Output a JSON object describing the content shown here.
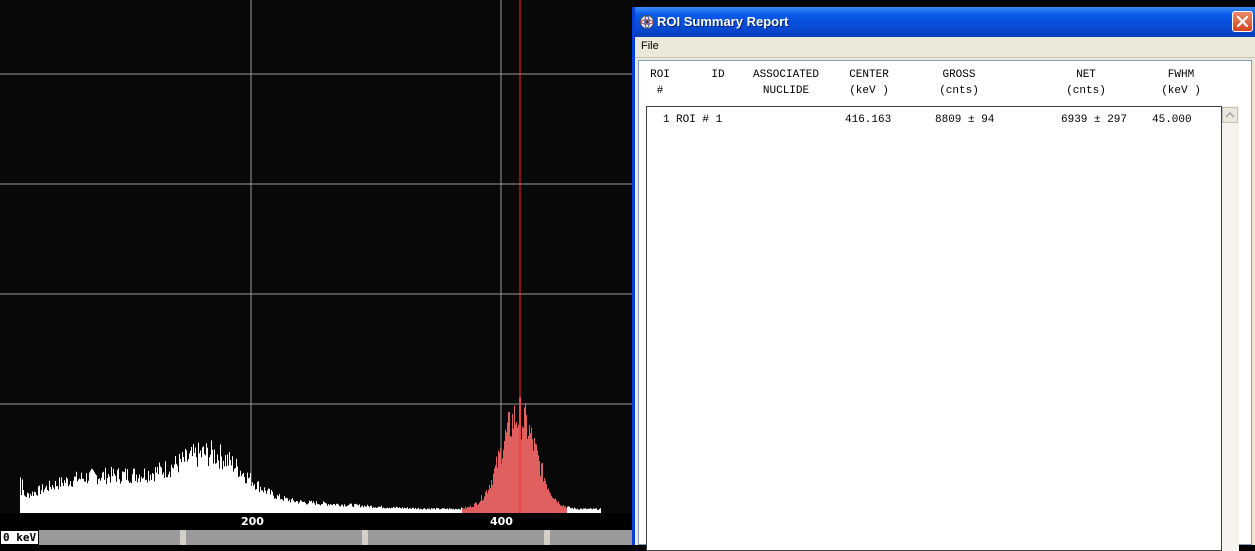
{
  "spectrum": {
    "axis_ticks": [
      {
        "label": "200"
      },
      {
        "label": "400"
      }
    ],
    "energy_label": "0 keV",
    "roi_color": "#e06060",
    "marker_color": "#ff2a2a",
    "trace_color": "#ffffff",
    "grid_color": "#9a9a9a"
  },
  "report_window": {
    "title": "ROI Summary Report",
    "menu": {
      "file": "File"
    },
    "columns": [
      {
        "key": "roi",
        "line1": "ROI",
        "line2": "#"
      },
      {
        "key": "id",
        "line1": "ID",
        "line2": ""
      },
      {
        "key": "nuclide",
        "line1": "ASSOCIATED",
        "line2": "NUCLIDE"
      },
      {
        "key": "center",
        "line1": "CENTER",
        "line2": "(keV )"
      },
      {
        "key": "gross",
        "line1": "GROSS",
        "line2": "(cnts)"
      },
      {
        "key": "net",
        "line1": "NET",
        "line2": "(cnts)"
      },
      {
        "key": "fwhm",
        "line1": "FWHM",
        "line2": "(keV )"
      }
    ],
    "rows": [
      {
        "roi": "1",
        "id": "ROI # 1",
        "center": "416.163",
        "gross": "8809 ± 94",
        "net": "6939 ± 297",
        "fwhm": "45.000"
      }
    ]
  }
}
